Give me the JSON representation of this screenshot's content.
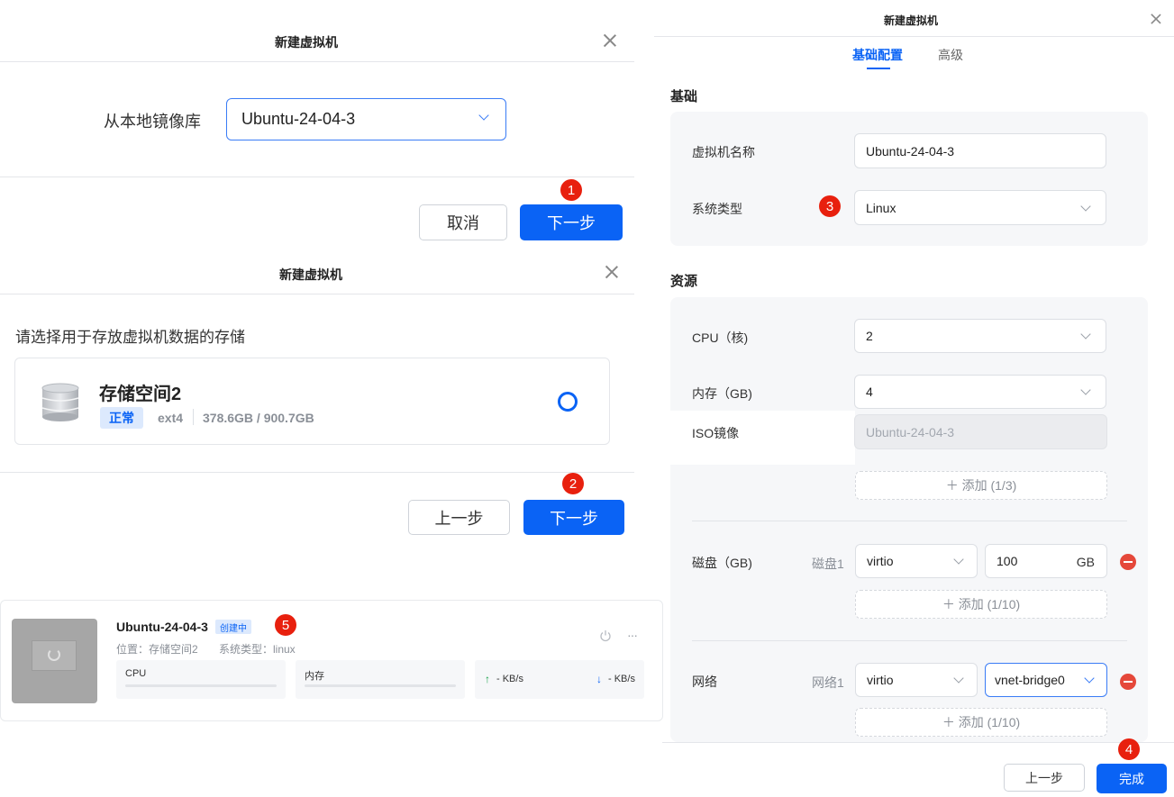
{
  "dialog1": {
    "title": "新建虚拟机",
    "source_label": "从本地镜像库",
    "image_select": "Ubuntu-24-04-3",
    "cancel": "取消",
    "next": "下一步",
    "step_badge": "1"
  },
  "dialog2": {
    "title": "新建虚拟机",
    "prompt": "请选择用于存放虚拟机数据的存储",
    "storage": {
      "name": "存储空间2",
      "status": "正常",
      "fs": "ext4",
      "usage": "378.6GB / 900.7GB"
    },
    "prev": "上一步",
    "next": "下一步",
    "step_badge": "2"
  },
  "vm_card": {
    "name": "Ubuntu-24-04-3",
    "status": "创建中",
    "location": "位置：存储空间2",
    "os_type": "系统类型：linux",
    "cpu_label": "CPU",
    "mem_label": "内存",
    "up_speed": "- KB/s",
    "down_speed": "- KB/s",
    "step_badge": "5",
    "more": "···"
  },
  "dialog3": {
    "title": "新建虚拟机",
    "tabs": [
      "基础配置",
      "高级"
    ],
    "active_tab": "基础配置",
    "basic_section": "基础",
    "vm_name_label": "虚拟机名称",
    "vm_name_value": "Ubuntu-24-04-3",
    "os_type_label": "系统类型",
    "os_type_value": "Linux",
    "step_badge_os": "3",
    "resource_section": "资源",
    "cpu_label": "CPU（核)",
    "cpu_value": "2",
    "mem_label": "内存（GB)",
    "mem_value": "4",
    "iso_label": "ISO镜像",
    "iso_value": "Ubuntu-24-04-3",
    "iso_add": "＋ 添加 (1/3)",
    "disk_label": "磁盘（GB)",
    "disk_sub": "磁盘1",
    "disk_bus": "virtio",
    "disk_size": "100",
    "disk_unit": "GB",
    "disk_add": "＋ 添加 (1/10)",
    "net_label": "网络",
    "net_sub": "网络1",
    "net_model": "virtio",
    "net_bridge": "vnet-bridge0",
    "net_add": "＋ 添加 (1/10)",
    "prev": "上一步",
    "finish": "完成",
    "step_badge_finish": "4"
  },
  "colors": {
    "primary": "#0a63f5",
    "badge": "#e8200e",
    "danger": "#e5483a",
    "panel_bg": "#f6f7f9"
  }
}
